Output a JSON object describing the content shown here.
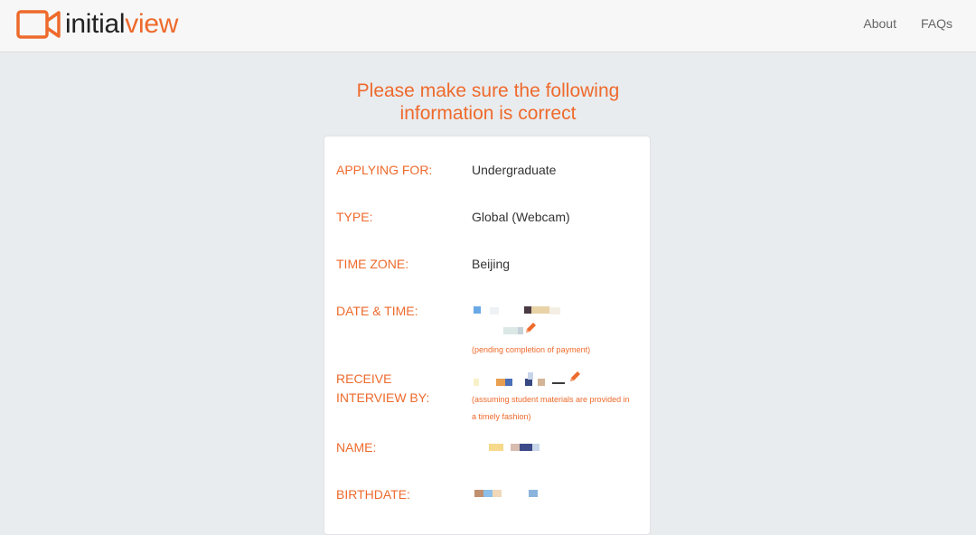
{
  "header": {
    "logo": {
      "initial": "initial",
      "view": "view"
    },
    "nav": {
      "about": "About",
      "faqs": "FAQs"
    }
  },
  "heading": {
    "line1": "Please make sure the following",
    "line2": "information is correct"
  },
  "details": {
    "applying_for": {
      "label": "APPLYING FOR:",
      "value": "Undergraduate"
    },
    "type": {
      "label": "TYPE:",
      "value": "Global (Webcam)"
    },
    "time_zone": {
      "label": "TIME ZONE:",
      "value": "Beijing"
    },
    "date_time": {
      "label": "DATE & TIME:",
      "note": "(pending completion of payment)"
    },
    "receive_interview_by": {
      "label_line1": "RECEIVE",
      "label_line2": "INTERVIEW BY:",
      "note_line1": "(assuming student materials are provided in",
      "note_line2": "a timely fashion)"
    },
    "name": {
      "label": "NAME:"
    },
    "birthdate": {
      "label": "BIRTHDATE:"
    }
  },
  "colors": {
    "accent": "#ee6a2c",
    "page_background": "#e9ecef",
    "text": "#333333"
  },
  "icons": {
    "logo": "video-camera-icon",
    "edit": "pencil-icon"
  }
}
